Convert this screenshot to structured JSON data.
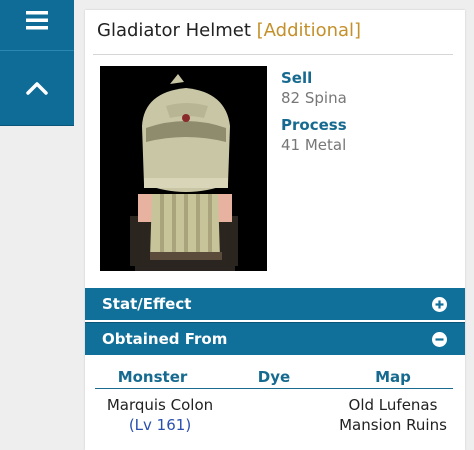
{
  "nav": {
    "menu_icon": "hamburger-icon",
    "up_icon": "chevron-up-icon"
  },
  "item": {
    "name": "Gladiator Helmet",
    "tag": "[Additional]",
    "sell_label": "Sell",
    "sell_value": "82 Spina",
    "process_label": "Process",
    "process_value": "41 Metal"
  },
  "accordions": {
    "stat_label": "Stat/Effect",
    "stat_icon": "plus-circle-icon",
    "obtained_label": "Obtained From",
    "obtained_icon": "minus-circle-icon"
  },
  "obtained_table": {
    "headers": [
      "Monster",
      "Dye",
      "Map"
    ],
    "rows": [
      {
        "monster": "Marquis Colon",
        "level": "(Lv 161)",
        "dye": "",
        "map_line1": "Old Lufenas",
        "map_line2": "Mansion Ruins"
      }
    ]
  },
  "colors": {
    "nav_bg": "#0e6c96",
    "accordion_bg": "#10709a",
    "label_blue": "#176a8f",
    "tag_gold": "#c4902b",
    "link_blue": "#2a4fb0"
  }
}
